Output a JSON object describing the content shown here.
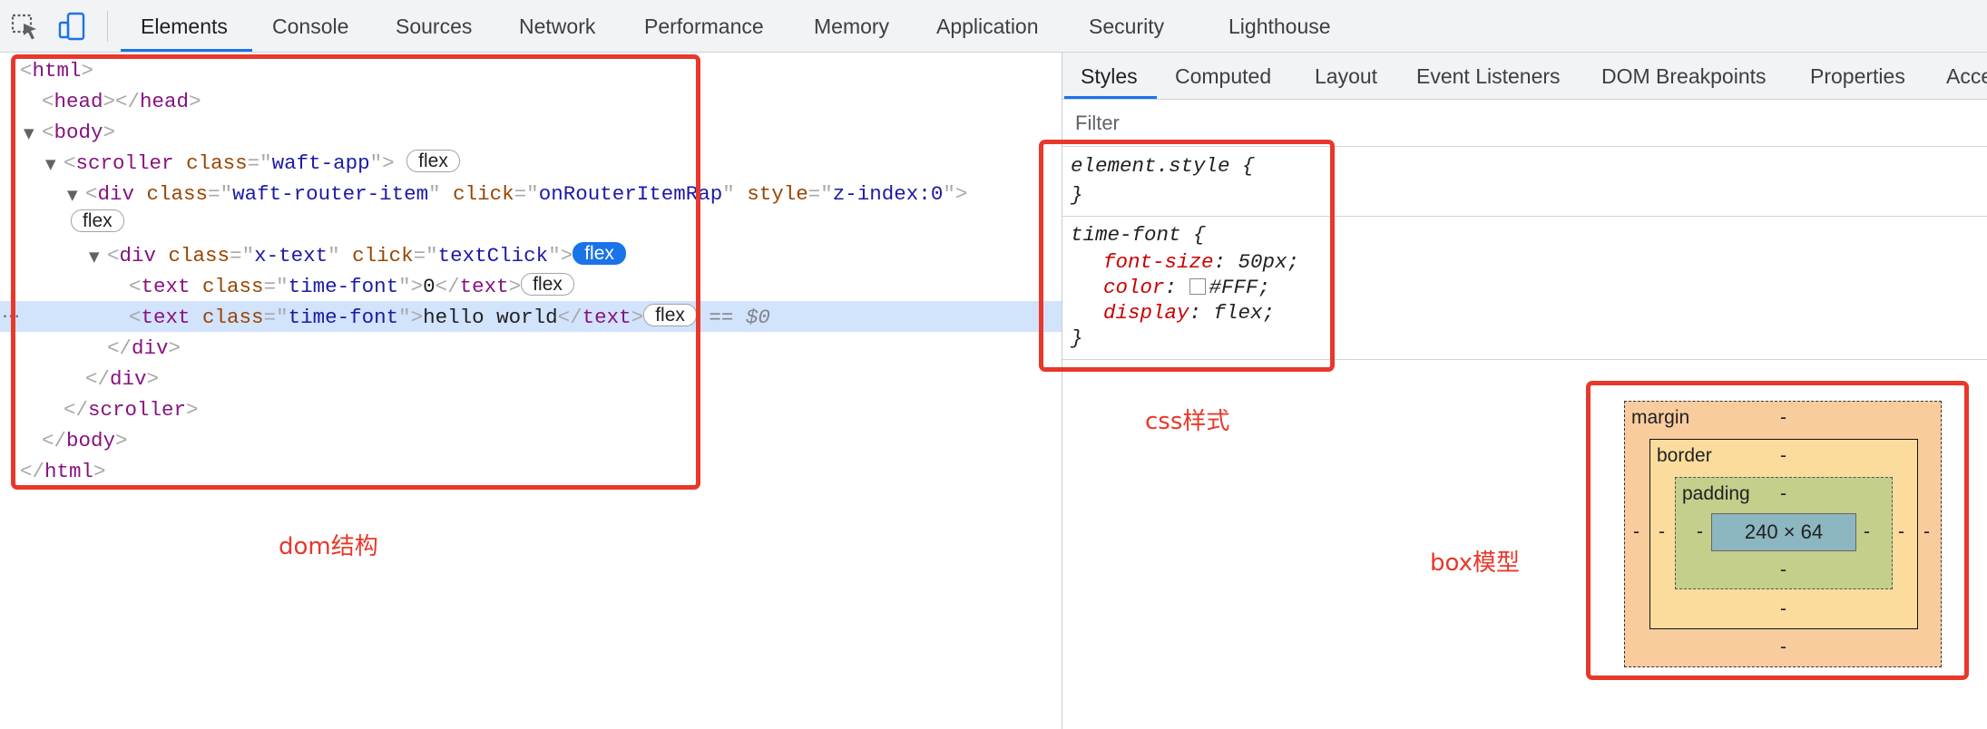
{
  "toolbar": {
    "inspect_icon": "inspect-element-icon",
    "device_icon": "device-toolbar-icon",
    "tabs": [
      {
        "label": "Elements",
        "active": true
      },
      {
        "label": "Console"
      },
      {
        "label": "Sources"
      },
      {
        "label": "Network"
      },
      {
        "label": "Performance"
      },
      {
        "label": "Memory"
      },
      {
        "label": "Application"
      },
      {
        "label": "Security"
      },
      {
        "label": "Lighthouse"
      }
    ]
  },
  "dom": {
    "l1": {
      "tag": "html"
    },
    "l2": {
      "tag": "head"
    },
    "l3": {
      "tag": "body"
    },
    "l4": {
      "tag": "scroller",
      "attr": "class",
      "val": "waft-app",
      "badge": "flex"
    },
    "l5": {
      "tag": "div",
      "a1": "class",
      "v1": "waft-router-item",
      "a2": "click",
      "v2": "onRouterItemRap",
      "a3": "style",
      "v3": "z-index:0",
      "badge": "flex"
    },
    "l6": {
      "tag": "div",
      "a1": "class",
      "v1": "x-text",
      "a2": "click",
      "v2": "textClick",
      "badge": "flex"
    },
    "l7": {
      "tag": "text",
      "attr": "class",
      "val": "time-font",
      "text": "0",
      "badge": "flex"
    },
    "l8": {
      "tag": "text",
      "attr": "class",
      "val": "time-font",
      "text": "hello world",
      "badge": "flex",
      "console_ref": "== $0"
    },
    "l9": {
      "tag": "div"
    },
    "l10": {
      "tag": "div"
    },
    "l11": {
      "tag": "scroller"
    },
    "l12": {
      "tag": "body"
    },
    "l13": {
      "tag": "html"
    }
  },
  "sidebar": {
    "tabs": [
      {
        "label": "Styles",
        "active": true
      },
      {
        "label": "Computed"
      },
      {
        "label": "Layout"
      },
      {
        "label": "Event Listeners"
      },
      {
        "label": "DOM Breakpoints"
      },
      {
        "label": "Properties"
      },
      {
        "label": "Acce"
      }
    ],
    "filter_placeholder": "Filter"
  },
  "styles": {
    "rule1": {
      "selector": "element.style {",
      "close": "}"
    },
    "rule2": {
      "selector": "time-font {",
      "props": [
        {
          "name": "font-size",
          "value": "50px;"
        },
        {
          "name": "color",
          "value": "#FFF;",
          "swatch": "#FFFFFF"
        },
        {
          "name": "display",
          "value": "flex;"
        }
      ],
      "close": "}"
    }
  },
  "box_model": {
    "margin_label": "margin",
    "border_label": "border",
    "padding_label": "padding",
    "content_size": "240 × 64",
    "dash": "-"
  },
  "annotations": {
    "dom": "dom结构",
    "css": "css样式",
    "box": "box模型",
    "color": "#e8382a"
  }
}
